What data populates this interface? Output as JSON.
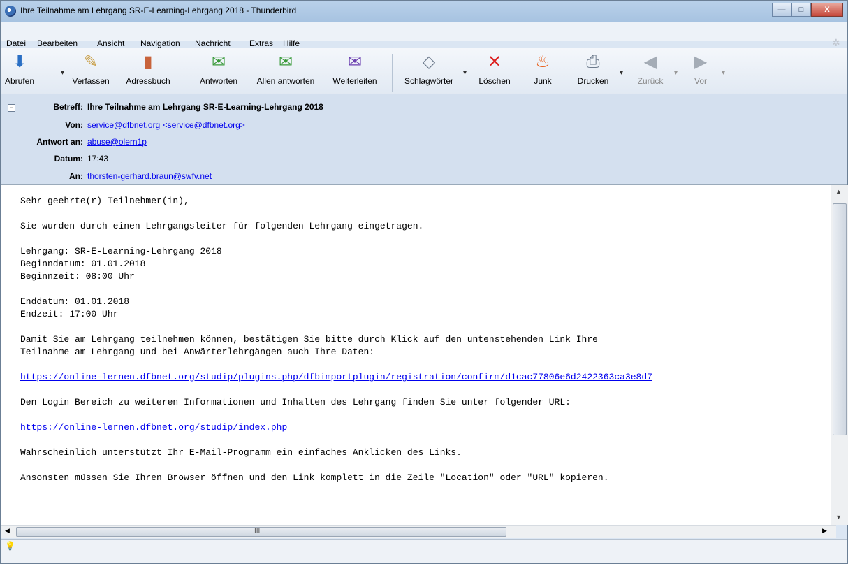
{
  "window": {
    "title": "Ihre Teilnahme am Lehrgang SR-E-Learning-Lehrgang 2018 - Thunderbird",
    "buttons": {
      "minimize": "—",
      "maximize": "□",
      "close": "X"
    }
  },
  "menubar": {
    "items": [
      "Datei",
      "Bearbeiten",
      "Ansicht",
      "Navigation",
      "Nachricht",
      "Extras",
      "Hilfe"
    ]
  },
  "toolbar": {
    "buttons": [
      {
        "label": "Abrufen",
        "icon": "get-mail-icon"
      },
      {
        "label": "Verfassen",
        "icon": "compose-icon"
      },
      {
        "label": "Adressbuch",
        "icon": "address-book-icon"
      },
      {
        "label": "Antworten",
        "icon": "reply-icon"
      },
      {
        "label": "Allen antworten",
        "icon": "reply-all-icon"
      },
      {
        "label": "Weiterleiten",
        "icon": "forward-icon"
      },
      {
        "label": "Schlagwörter",
        "icon": "tag-icon"
      },
      {
        "label": "Löschen",
        "icon": "delete-icon"
      },
      {
        "label": "Junk",
        "icon": "junk-icon"
      },
      {
        "label": "Drucken",
        "icon": "print-icon"
      },
      {
        "label": "Zurück",
        "icon": "back-icon"
      },
      {
        "label": "Vor",
        "icon": "forward-nav-icon"
      }
    ]
  },
  "header": {
    "subject_label": "Betreff:",
    "subject": "Ihre Teilnahme am Lehrgang SR-E-Learning-Lehrgang 2018",
    "from_label": "Von:",
    "from": "service@dfbnet.org <service@dfbnet.org>",
    "reply_to_label": "Antwort an:",
    "reply_to": "abuse@olern1p",
    "date_label": "Datum:",
    "date": "17:43",
    "to_label": "An:",
    "to": "thorsten-gerhard.braun@swfv.net"
  },
  "body": {
    "line1": "Sehr geehrte(r) Teilnehmer(in),",
    "line2": "Sie wurden durch einen Lehrgangsleiter für folgenden Lehrgang eingetragen.",
    "line3": "Lehrgang: SR-E-Learning-Lehrgang 2018",
    "line4": "Beginndatum: 01.01.2018",
    "line5": "Beginnzeit: 08:00 Uhr",
    "line6": "Enddatum: 01.01.2018",
    "line7": "Endzeit: 17:00 Uhr",
    "line8": "Damit Sie am Lehrgang teilnehmen können, bestätigen Sie bitte durch Klick auf den untenstehenden Link Ihre",
    "line9": "Teilnahme am Lehrgang und bei Anwärterlehrgängen auch Ihre Daten:",
    "link1": "https://online-lernen.dfbnet.org/studip/plugins.php/dfbimportplugin/registration/confirm/d1cac77806e6d2422363ca3e8d7",
    "line10": "Den Login Bereich zu weiteren Informationen und Inhalten des Lehrgang finden Sie unter folgender URL:",
    "link2": "https://online-lernen.dfbnet.org/studip/index.php",
    "line11": "Wahrscheinlich unterstützt Ihr E-Mail-Programm ein einfaches Anklicken des Links.",
    "line12": "Ansonsten müssen Sie Ihren Browser öffnen und den Link komplett in die Zeile \"Location\" oder \"URL\" kopieren."
  },
  "scrollbar": {
    "h_thumb_grip": "III"
  }
}
